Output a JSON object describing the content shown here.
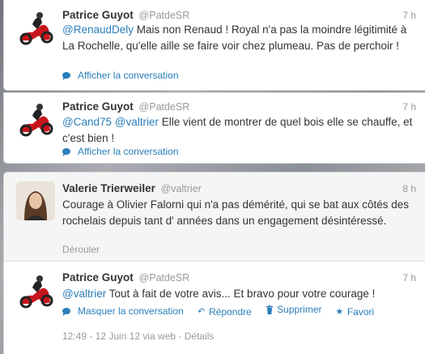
{
  "tweets": [
    {
      "fullname": "Patrice Guyot",
      "username": "@PatdeSR",
      "time": "7 h",
      "mention": "@RenaudDely",
      "text": " Mais non Renaud ! Royal n'a pas la moindre légitimité à La Rochelle, qu'elle aille se faire voir chez plumeau. Pas de perchoir !",
      "action": "Afficher la conversation"
    },
    {
      "fullname": "Patrice Guyot",
      "username": "@PatdeSR",
      "time": "7 h",
      "mention1": "@Cand75",
      "mention2": "@valtrier",
      "text": " Elle vient de montrer de quel bois elle se chauffe, et c'est bien !",
      "action": "Afficher la conversation"
    },
    {
      "fullname": "Valerie Trierweiler",
      "username": "@valtrier",
      "time": "8 h",
      "text": "Courage à Olivier Falorni qui n'a pas démérité, qui se bat aux côtés des rochelais depuis tant d' années dans un engagement désintéressé.",
      "action": "Dérouler"
    },
    {
      "fullname": "Patrice Guyot",
      "username": "@PatdeSR",
      "time": "7 h",
      "mention": "@valtrier",
      "text": " Tout à fait de votre avis... Et bravo pour votre courage !",
      "actions": {
        "hide": "Masquer la conversation",
        "reply": "Répondre",
        "delete": "Supprimer",
        "favorite": "Favori"
      },
      "meta": "12:49 - 12 Juin 12 via web · Détails"
    }
  ],
  "colors": {
    "link": "#2a7eb8",
    "muted": "#999999",
    "text": "#333333"
  }
}
